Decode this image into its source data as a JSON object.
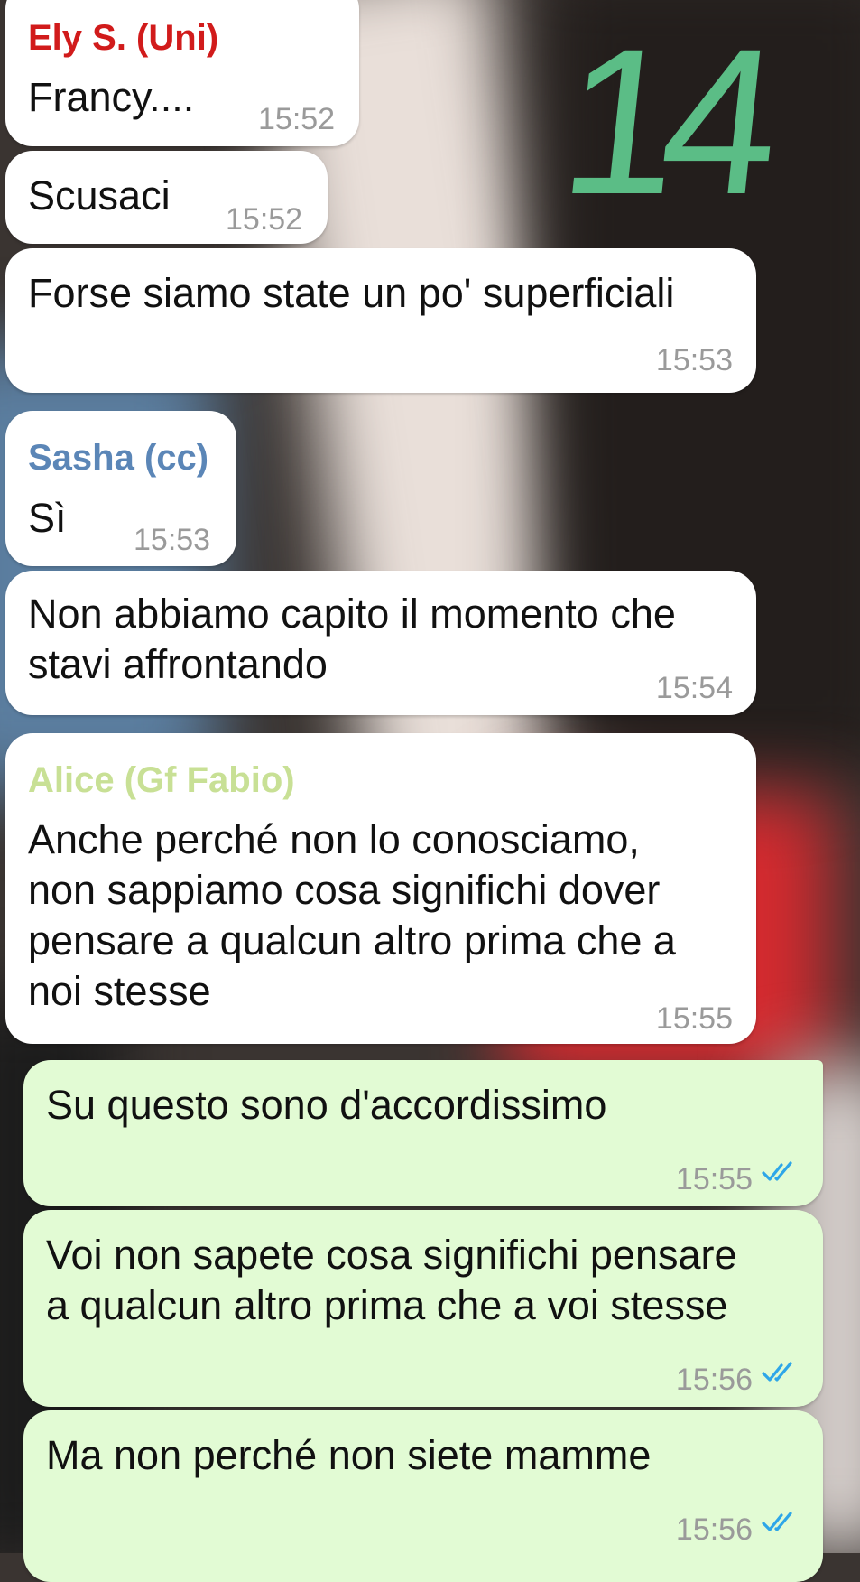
{
  "annotation": {
    "page_number": "14",
    "color": "#5bbd86"
  },
  "colors": {
    "incoming_bubble": "#ffffff",
    "outgoing_bubble": "#e2fbd4",
    "sender_ely": "#d11b1b",
    "sender_sasha": "#5b86b7",
    "sender_alice": "#c8e095",
    "read_ticks": "#2ea6e8",
    "timestamp": "#9a9a9a"
  },
  "messages": [
    {
      "sender": "Ely S. (Uni)",
      "text": "Francy....",
      "time": "15:52"
    },
    {
      "text": "Scusaci",
      "time": "15:52"
    },
    {
      "text": "Forse siamo state un po' superficiali",
      "time": "15:53"
    },
    {
      "sender": "Sasha (cc)",
      "text": "Sì",
      "time": "15:53"
    },
    {
      "text": "Non abbiamo capito il momento che\nstavi affrontando",
      "time": "15:54"
    },
    {
      "sender": "Alice (Gf Fabio)",
      "text": "Anche perché non lo conosciamo,\nnon sappiamo cosa significhi dover\npensare a qualcun altro prima che a\nnoi stesse",
      "time": "15:55"
    },
    {
      "text": "Su questo sono d'accordissimo",
      "time": "15:55",
      "status": "read-double-check-icon"
    },
    {
      "text": "Voi non sapete cosa significhi pensare\na qualcun altro prima che a voi stesse",
      "time": "15:56",
      "status": "read-double-check-icon"
    },
    {
      "text": "Ma non perché non siete mamme",
      "time": "15:56",
      "status": "read-double-check-icon"
    }
  ]
}
